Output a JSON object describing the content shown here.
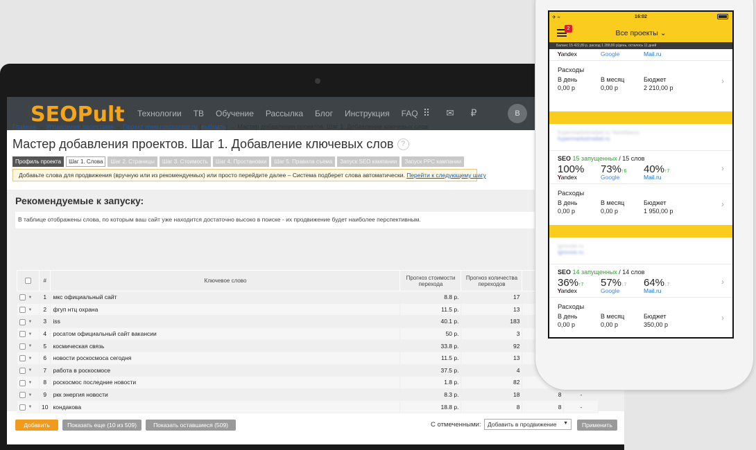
{
  "nav": {
    "logo": "SEOPult",
    "menu": [
      "Технологии",
      "ТВ",
      "Обучение",
      "Рассылка",
      "Блог",
      "Инструкция",
      "FAQ"
    ],
    "icons": [
      "apps-grid-icon",
      "mail-icon",
      "ruble-icon"
    ],
    "avatar": "В"
  },
  "breadcrumb": {
    "home": "Главная",
    "sep": "→",
    "projects": "Управление проектами",
    "project": "Проект www.roscosmos.ru",
    "choose": "выбрать",
    "current": "Мастер добавления проектов. Шаг 1. Добавление ключевых слов"
  },
  "page": {
    "title": "Мастер добавления проектов. Шаг 1. Добавление ключевых слов",
    "help": "?"
  },
  "steps": [
    "Профиль проекта",
    "Шаг 1. Слова",
    "Шаг 2. Страницы",
    "Шаг 3. Стоимость",
    "Шаг 4. Простановки",
    "Шаг 5. Правила съема",
    "Запуск SEO кампании",
    "Запуск PPC кампании"
  ],
  "notice": {
    "text": "Добавьте слова для продвижения (вручную или из рекомендуемых) или просто перейдите далее – Система подберет слова автоматически.",
    "link": "Перейти к следующему шагу"
  },
  "section": {
    "title": "Рекомендуемые к запуску:",
    "desc": "В таблице отображены слова, по которым ваш сайт уже находится достаточно высоко в поиске - их продвижение будет наиболее перспективным."
  },
  "table": {
    "headers": [
      "#",
      "Ключевое слово",
      "Прогноз стоимости перехода",
      "Прогноз количества переходов"
    ],
    "rows": [
      {
        "n": "1",
        "kw": "мкс официальный сайт",
        "cost": "8.8 р.",
        "cnt": "17",
        "a": "",
        "b": ""
      },
      {
        "n": "2",
        "kw": "фгуп нтц охрана",
        "cost": "11.5 р.",
        "cnt": "13",
        "a": "",
        "b": ""
      },
      {
        "n": "3",
        "kw": "iss",
        "cost": "40.1 р.",
        "cnt": "183",
        "a": "",
        "b": ""
      },
      {
        "n": "4",
        "kw": "росатом официальный сайт вакансии",
        "cost": "50 р.",
        "cnt": "3",
        "a": "",
        "b": ""
      },
      {
        "n": "5",
        "kw": "космическая связь",
        "cost": "33.8 р.",
        "cnt": "92",
        "a": "",
        "b": ""
      },
      {
        "n": "6",
        "kw": "новости роскосмоса сегодня",
        "cost": "11.5 р.",
        "cnt": "13",
        "a": "",
        "b": ""
      },
      {
        "n": "7",
        "kw": "работа в роскосмосе",
        "cost": "37.5 р.",
        "cnt": "4",
        "a": "",
        "b": ""
      },
      {
        "n": "8",
        "kw": "роскосмос последние новости",
        "cost": "1.8 р.",
        "cnt": "82",
        "a": "",
        "b": ""
      },
      {
        "n": "9",
        "kw": "ркк энергия новости",
        "cost": "8.3 р.",
        "cnt": "18",
        "a": "8",
        "b": "-"
      },
      {
        "n": "10",
        "kw": "кондакова",
        "cost": "18.8 р.",
        "cnt": "8",
        "a": "8",
        "b": "-"
      }
    ]
  },
  "actions": {
    "add": "Добавить",
    "more": "Показать еще (10 из 509)",
    "rest": "Показать оставшиеся (509)",
    "selected_label": "С отмеченными:",
    "selected_value": "Добавить в продвижение",
    "apply": "Применить"
  },
  "phone": {
    "time": "16:02",
    "badge": "2",
    "title": "Все проекты",
    "balance": "Баланс 15 422,89 р, расход 1 288,80 р/день, осталось 11 дней",
    "engines": [
      "Yandex",
      "Google",
      "Mail.ru"
    ],
    "labels": {
      "expenses": "Расходы",
      "per_day": "В день",
      "per_month": "В месяц",
      "budget": "Бюджет",
      "seo": "SEO"
    },
    "card0": {
      "day": "0,00 р",
      "month": "0,00 р",
      "budget": "2 210,00 р"
    },
    "card1": {
      "blur1": "hypermarketmebel.ru Челябинск",
      "blur2": "hypermarketmebel.ru",
      "running": "15 запущенных",
      "total": "/ 15 слов",
      "pct": [
        "100%",
        "73%",
        "40%"
      ],
      "delta": [
        "",
        "↑6",
        "↑7"
      ],
      "day": "0,00 р",
      "month": "0,00 р",
      "budget": "1 950,00 р"
    },
    "card2": {
      "blur1": "igrovoie.ru",
      "blur2": "igrovoie.ru",
      "running": "14 запущенных",
      "total": "/ 14 слов",
      "pct": [
        "36%",
        "57%",
        "64%"
      ],
      "delta": [
        "↑7",
        "↓7",
        "↓7"
      ],
      "day": "0,00 р",
      "month": "0,00 р",
      "budget": "350,00 р"
    }
  }
}
